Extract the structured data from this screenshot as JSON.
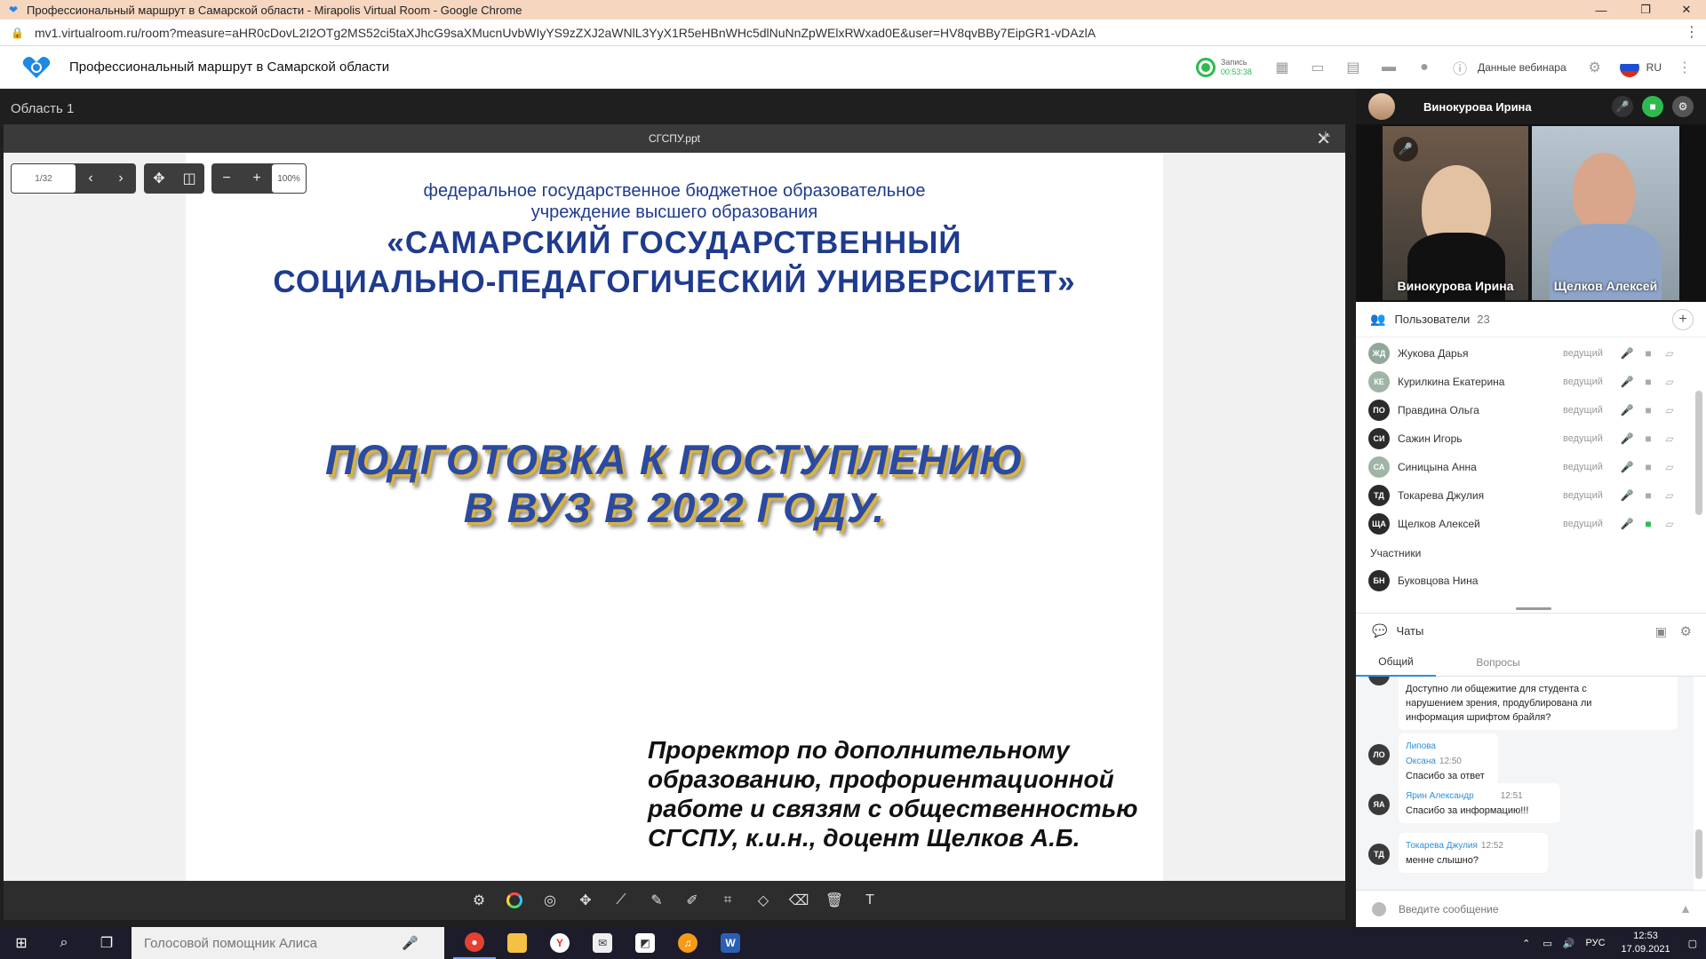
{
  "browser": {
    "title": "Профессиональный маршрут в Самарской области - Mirapolis Virtual Room - Google Chrome",
    "url": "mv1.virtualroom.ru/room?measure=aHR0cDovL2I2OTg2MS52ci5taXJhcG9saXMucnUvbWIyYS9zZXJ2aWNlL3YyX1R5eHBnWHc5dlNuNnZpWElxRWxad0E&user=HV8qvBBy7EipGR1-vDAzlA"
  },
  "app": {
    "title": "Профессиональный маршрут в Самарской области",
    "record_label": "Запись",
    "record_time": "00:53:38",
    "webinar_label": "Данные вебинара",
    "language": "RU"
  },
  "main": {
    "area_title": "Область 1",
    "doc_title": "СГСПУ.ppt",
    "page_indicator": "1/32",
    "zoom": "100%"
  },
  "slide": {
    "line1": "федеральное государственное бюджетное образовательное",
    "line2": "учреждение  высшего образования",
    "univ1": "«САМАРСКИЙ ГОСУДАРСТВЕННЫЙ",
    "univ2": "СОЦИАЛЬНО-ПЕДАГОГИЧЕСКИЙ УНИВЕРСИТЕТ»",
    "main1": "ПОДГОТОВКА К ПОСТУПЛЕНИЮ",
    "main2": "В ВУЗ В 2022 ГОДУ.",
    "prorector1": "Проректор по дополнительному",
    "prorector2": "образованию, профориентационной",
    "prorector3": "работе и связям с общественностью",
    "prorector4": "СГСПУ, к.и.н., доцент Щелков А.Б."
  },
  "video": {
    "host_name": "Винокурова Ирина",
    "tile1_label": "Винокурова Ирина",
    "tile2_label": "Щелков Алексей"
  },
  "users": {
    "label": "Пользователи",
    "count": "23",
    "hosts": [
      {
        "initials": "ЖД",
        "name": "Жукова Дарья",
        "role": "ведущий",
        "color": "#8fa89a"
      },
      {
        "initials": "КЕ",
        "name": "Курилкина Екатерина",
        "role": "ведущий",
        "color": "#9fb5a5"
      },
      {
        "initials": "ПО",
        "name": "Правдина Ольга",
        "role": "ведущий",
        "color": "#2b2b2b"
      },
      {
        "initials": "СИ",
        "name": "Сажин Игорь",
        "role": "ведущий",
        "color": "#2b2b2b"
      },
      {
        "initials": "СА",
        "name": "Синицына Анна",
        "role": "ведущий",
        "color": "#9fb5a5"
      },
      {
        "initials": "ТД",
        "name": "Токарева Джулия",
        "role": "ведущий",
        "color": "#2b2b2b"
      },
      {
        "initials": "ЩА",
        "name": "Щелков Алексей",
        "role": "ведущий",
        "color": "#2b2b2b"
      }
    ],
    "participants_label": "Участники",
    "participants": [
      {
        "initials": "БН",
        "name": "Буковцова Нина",
        "color": "#2b2b2b"
      }
    ]
  },
  "chat": {
    "label": "Чаты",
    "tab_general": "Общий",
    "tab_questions": "Вопросы",
    "messages": [
      {
        "initials": "",
        "author": "",
        "time": "",
        "line1": "Доступно ли общежитие для студента с",
        "line2": "нарушением зрения, продублирована ли",
        "line3": "информация шрифтом брайля?"
      },
      {
        "initials": "ЛО",
        "author": "Липова Оксана",
        "time": "12:50",
        "line1": "Спасибо за ответ"
      },
      {
        "initials": "ЯА",
        "author": "Ярин Александр",
        "time": "12:51",
        "line1": "Спасибо за информацию!!!"
      },
      {
        "initials": "ТД",
        "author": "Токарева Джулия",
        "time": "12:52",
        "line1": "менне слышно?"
      }
    ],
    "input_placeholder": "Введите сообщение"
  },
  "taskbar": {
    "search_placeholder": "Голосовой помощник Алиса",
    "lang": "РУС",
    "time": "12:53",
    "date": "17.09.2021"
  },
  "colors": {
    "accent_green": "#2dbb4f",
    "slide_blue": "#1f3b8e",
    "chat_author": "#2e8fd9"
  }
}
